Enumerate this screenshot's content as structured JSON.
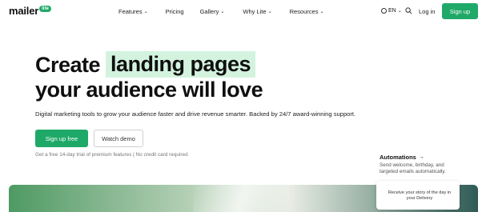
{
  "logo": {
    "word": "mailer",
    "badge": "lite"
  },
  "nav": {
    "links": [
      {
        "label": "Features",
        "dropdown": true
      },
      {
        "label": "Pricing",
        "dropdown": false
      },
      {
        "label": "Gallery",
        "dropdown": true
      },
      {
        "label": "Why Lite",
        "dropdown": true
      },
      {
        "label": "Resources",
        "dropdown": true
      }
    ],
    "language": "EN",
    "login": "Log in",
    "signup": "Sign up"
  },
  "hero": {
    "line1_prefix": "Create",
    "line1_highlight": "landing pages",
    "line2": "your audience will love",
    "subtitle": "Digital marketing tools to grow your audience faster and drive revenue smarter. Backed by 24/7 award-winning support.",
    "primary_button": "Sign up free",
    "secondary_button": "Watch demo",
    "fine_print": "Get a free 14-day trial of premium features | No credit card required"
  },
  "callout": {
    "title": "Automations",
    "description": "Send welcome, birthday, and targeted emails automatically."
  },
  "card": {
    "text": "Receive your story of the day in your Delivery"
  },
  "colors": {
    "accent": "#1fa968",
    "highlight": "#d3f3df"
  }
}
